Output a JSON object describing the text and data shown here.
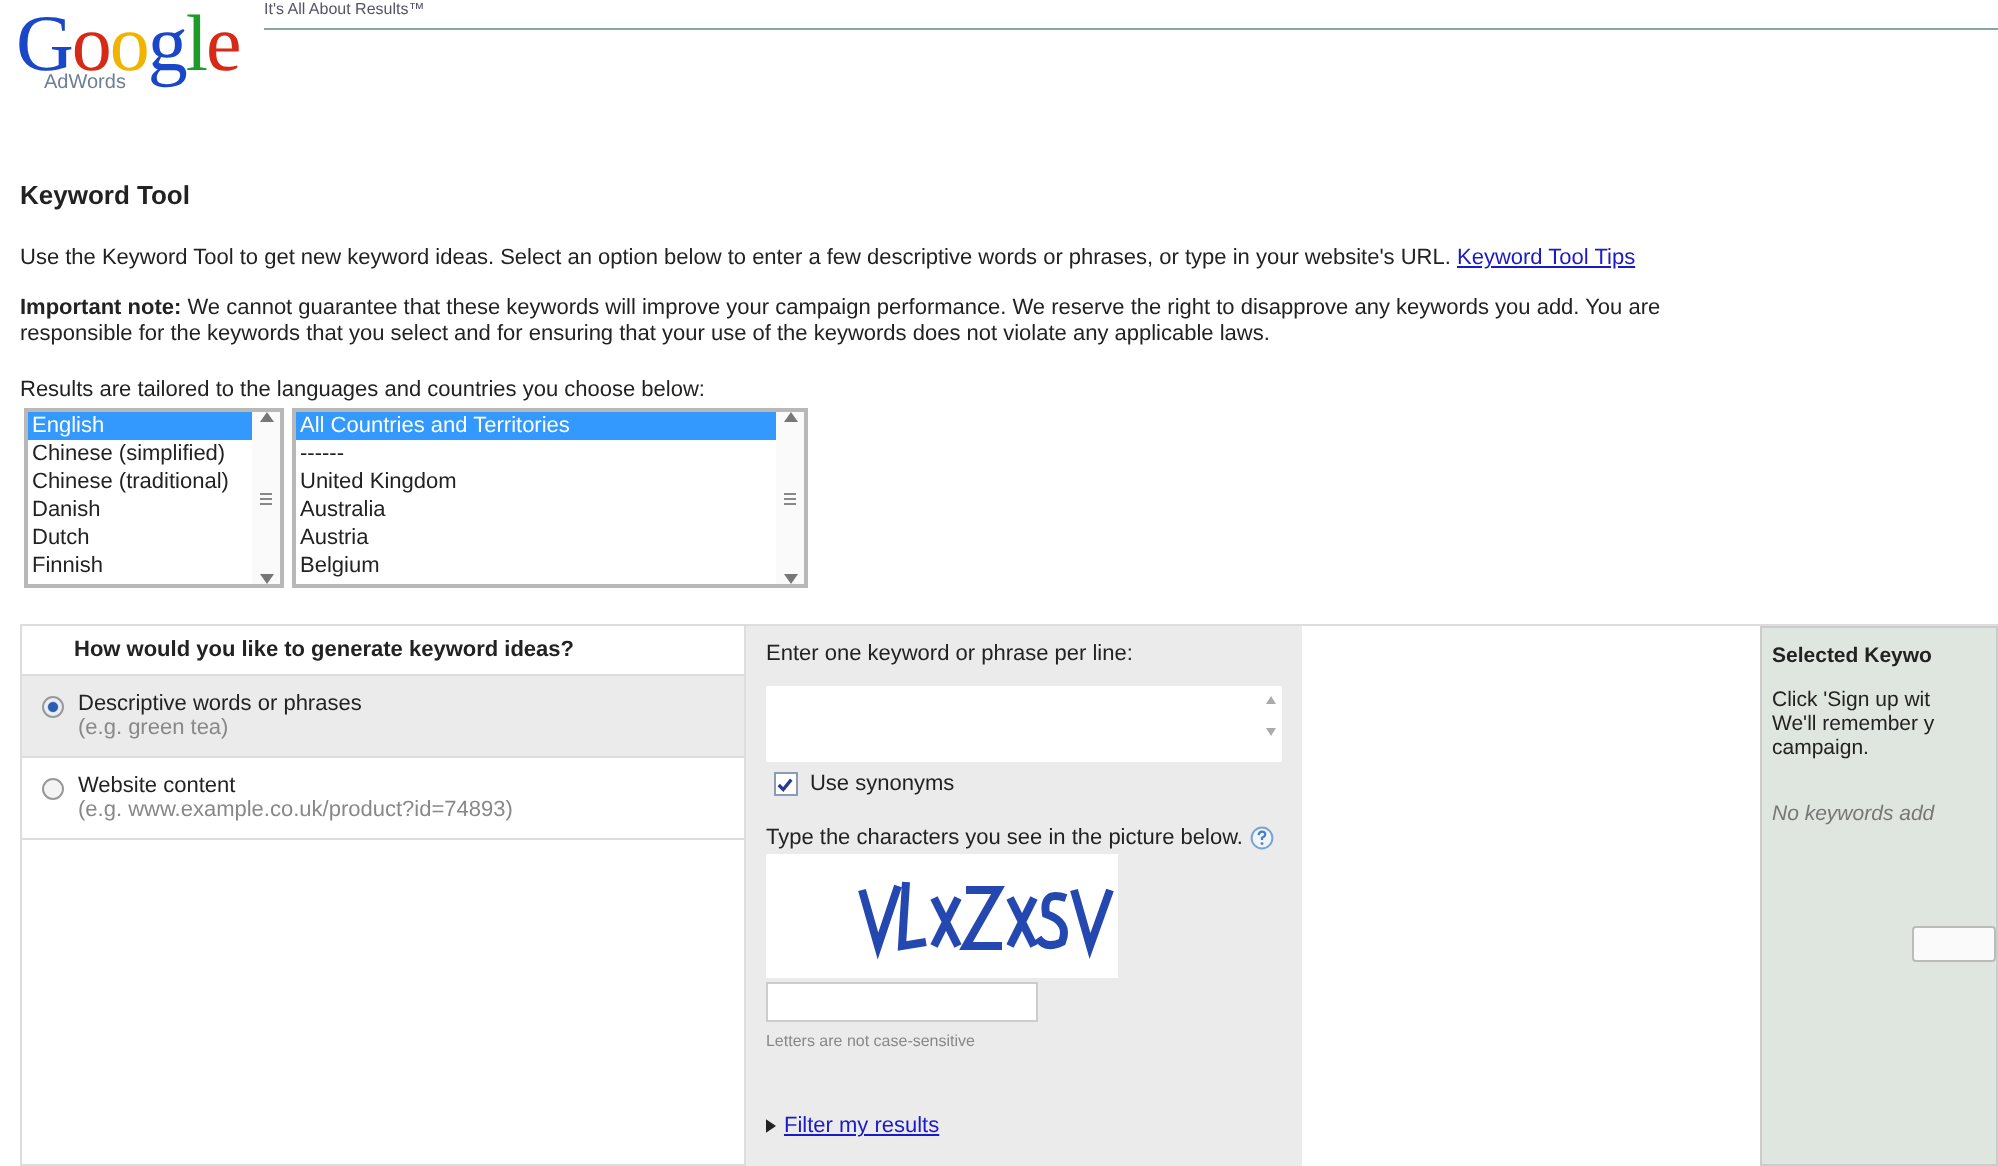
{
  "header": {
    "logo_text": "Google",
    "logo_subtext": "AdWords",
    "tagline": "It's All About Results™"
  },
  "title": "Keyword Tool",
  "intro": {
    "text": "Use the Keyword Tool to get new keyword ideas. Select an option below to enter a few descriptive words or phrases, or type in your website's URL.",
    "link": "Keyword Tool Tips"
  },
  "note": "**Important note:** We cannot guarantee that these keywords will improve your campaign performance. We reserve the right to disapprove any keywords you add. You are responsible for the keywords that you select and for ensuring that your use of the keywords does not violate any applicable laws.",
  "targeting": {
    "label": "Results are tailored to the languages and countries you choose below:",
    "languages": [
      {
        "label": "English",
        "selected": true
      },
      {
        "label": "Chinese (simplified)",
        "selected": false
      },
      {
        "label": "Chinese (traditional)",
        "selected": false
      },
      {
        "label": "Danish",
        "selected": false
      },
      {
        "label": "Dutch",
        "selected": false
      },
      {
        "label": "Finnish",
        "selected": false
      }
    ],
    "countries": [
      {
        "label": "All Countries and Territories",
        "selected": true
      },
      {
        "label": "------",
        "selected": false
      },
      {
        "label": "United Kingdom",
        "selected": false
      },
      {
        "label": "Australia",
        "selected": false
      },
      {
        "label": "Austria",
        "selected": false
      },
      {
        "label": "Belgium",
        "selected": false
      }
    ]
  },
  "options": {
    "heading": "How would you like to generate keyword ideas?",
    "items": [
      {
        "label": "Descriptive words or phrases",
        "hint": "(e.g. green tea)",
        "selected": true
      },
      {
        "label": "Website content",
        "hint": "(e.g. www.example.co.uk/product?id=74893)",
        "selected": false
      }
    ]
  },
  "entry": {
    "label": "Enter one keyword or phrase per line:",
    "synonyms": {
      "label": "Use synonyms",
      "checked": true
    },
    "captcha_label": "Type the characters you see in the picture below.",
    "captcha_note": "Letters are not case-sensitive",
    "filter_link": "Filter my results"
  },
  "selected_panel": {
    "heading": "Selected Keywo",
    "text_lines": [
      "Click 'Sign up wit",
      "We'll remember y",
      "campaign."
    ],
    "empty": "No keywords add"
  }
}
